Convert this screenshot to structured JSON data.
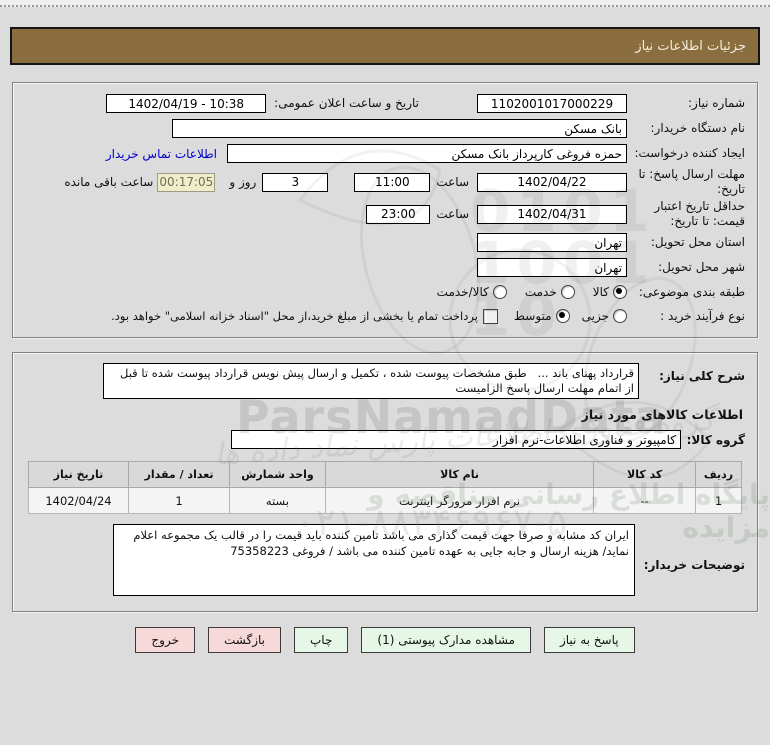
{
  "window": {
    "title": "جزئیات اطلاعات نیاز"
  },
  "form": {
    "need_number": {
      "label": "شماره نیاز:",
      "value": "1102001017000229"
    },
    "announce_datetime": {
      "label": "تاریخ و ساعت اعلان عمومی:",
      "value": "1402/04/19 - 10:38"
    },
    "buyer_org": {
      "label": "نام دستگاه خریدار:",
      "value": "بانک مسکن"
    },
    "request_creator": {
      "label": "ایجاد کننده درخواست:",
      "value": "حمزه فروغی کارپرداز بانک مسکن",
      "contact_link": "اطلاعات تماس خریدار"
    },
    "reply_deadline": {
      "label": "مهلت ارسال پاسخ: تا تاریخ:",
      "date": "1402/04/22",
      "hour_label": "ساعت",
      "time": "11:00",
      "days": "3",
      "days_label": "روز و",
      "countdown": "00:17:05",
      "remaining_label": "ساعت باقی مانده"
    },
    "price_validity": {
      "label": "حداقل تاریخ اعتبار قیمت: تا تاریخ:",
      "date": "1402/04/31",
      "hour_label": "ساعت",
      "time": "23:00"
    },
    "province": {
      "label": "استان محل تحویل:",
      "value": "تهران"
    },
    "city": {
      "label": "شهر محل تحویل:",
      "value": "تهران"
    },
    "classification": {
      "label": "طبقه بندی موضوعی:",
      "options": [
        {
          "label": "کالا",
          "selected": true
        },
        {
          "label": "خدمت",
          "selected": false
        },
        {
          "label": "کالا/خدمت",
          "selected": false
        }
      ]
    },
    "process_type": {
      "label": "نوع فرآیند خرید :",
      "options": [
        {
          "label": "جزیی",
          "selected": false
        },
        {
          "label": "متوسط",
          "selected": true
        }
      ],
      "treasury_checkbox_label": "پرداخت تمام یا بخشی از مبلغ خرید،از محل \"اسناد خزانه اسلامی\" خواهد بود."
    }
  },
  "need_description": {
    "label": "شرح کلی نیاز:",
    "text": "قرارداد پهنای باند ...   طبق مشخصات پیوست شده ، تکمیل و ارسال پیش نویس قرارداد پیوست شده تا قبل از اتمام مهلت ارسال پاسخ الزامیست"
  },
  "goods_section": {
    "heading": "اطلاعات کالاهای مورد نیاز",
    "group": {
      "label": "گروه کالا:",
      "value": "کامپیوتر و فناوری اطلاعات-نرم افزار"
    },
    "table": {
      "headers": [
        "ردیف",
        "کد کالا",
        "نام کالا",
        "واحد شمارش",
        "تعداد / مقدار",
        "تاریخ نیاز"
      ],
      "rows": [
        {
          "index": "1",
          "code": "--",
          "name": "نرم افزار مرورگر اینترنت",
          "unit": "بسته",
          "qty": "1",
          "need_date": "1402/04/24"
        }
      ]
    }
  },
  "buyer_notes": {
    "label": "توضیحات خریدار:",
    "text": "ایران کد مشابه و صرفا جهت قیمت گذاری می باشد تامین کننده باید قیمت را در قالب یک مجموعه اعلام نماید/ هزینه ارسال و جابه جایی به عهده تامین کننده می باشد / فروغی 75358223"
  },
  "buttons": {
    "reply": "پاسخ به نیاز",
    "attachments": "مشاهده مدارک پیوستی (1)",
    "print": "چاپ",
    "back": "بازگشت",
    "exit": "خروج"
  },
  "watermark": {
    "brand": "ParsNamadData",
    "line1": "گروه فناوری اطلاعات پارس نماد داده ها",
    "line2": "پایگاه اطلاع رسانی مناقصه و مزایده",
    "phone": "۰۲۱-۸۸۳۴۶۹۶۷-۵",
    "digits_a": "0101",
    "digits_b": "1001",
    "digits_c": "10"
  },
  "colors": {
    "titlebar": "#8b6e3f",
    "titlebar_text": "#f3ecda",
    "button_green": "#e7f7e7",
    "button_pink": "#f8d9d9",
    "countdown_bg": "#efeec9",
    "link": "#0000cc"
  }
}
